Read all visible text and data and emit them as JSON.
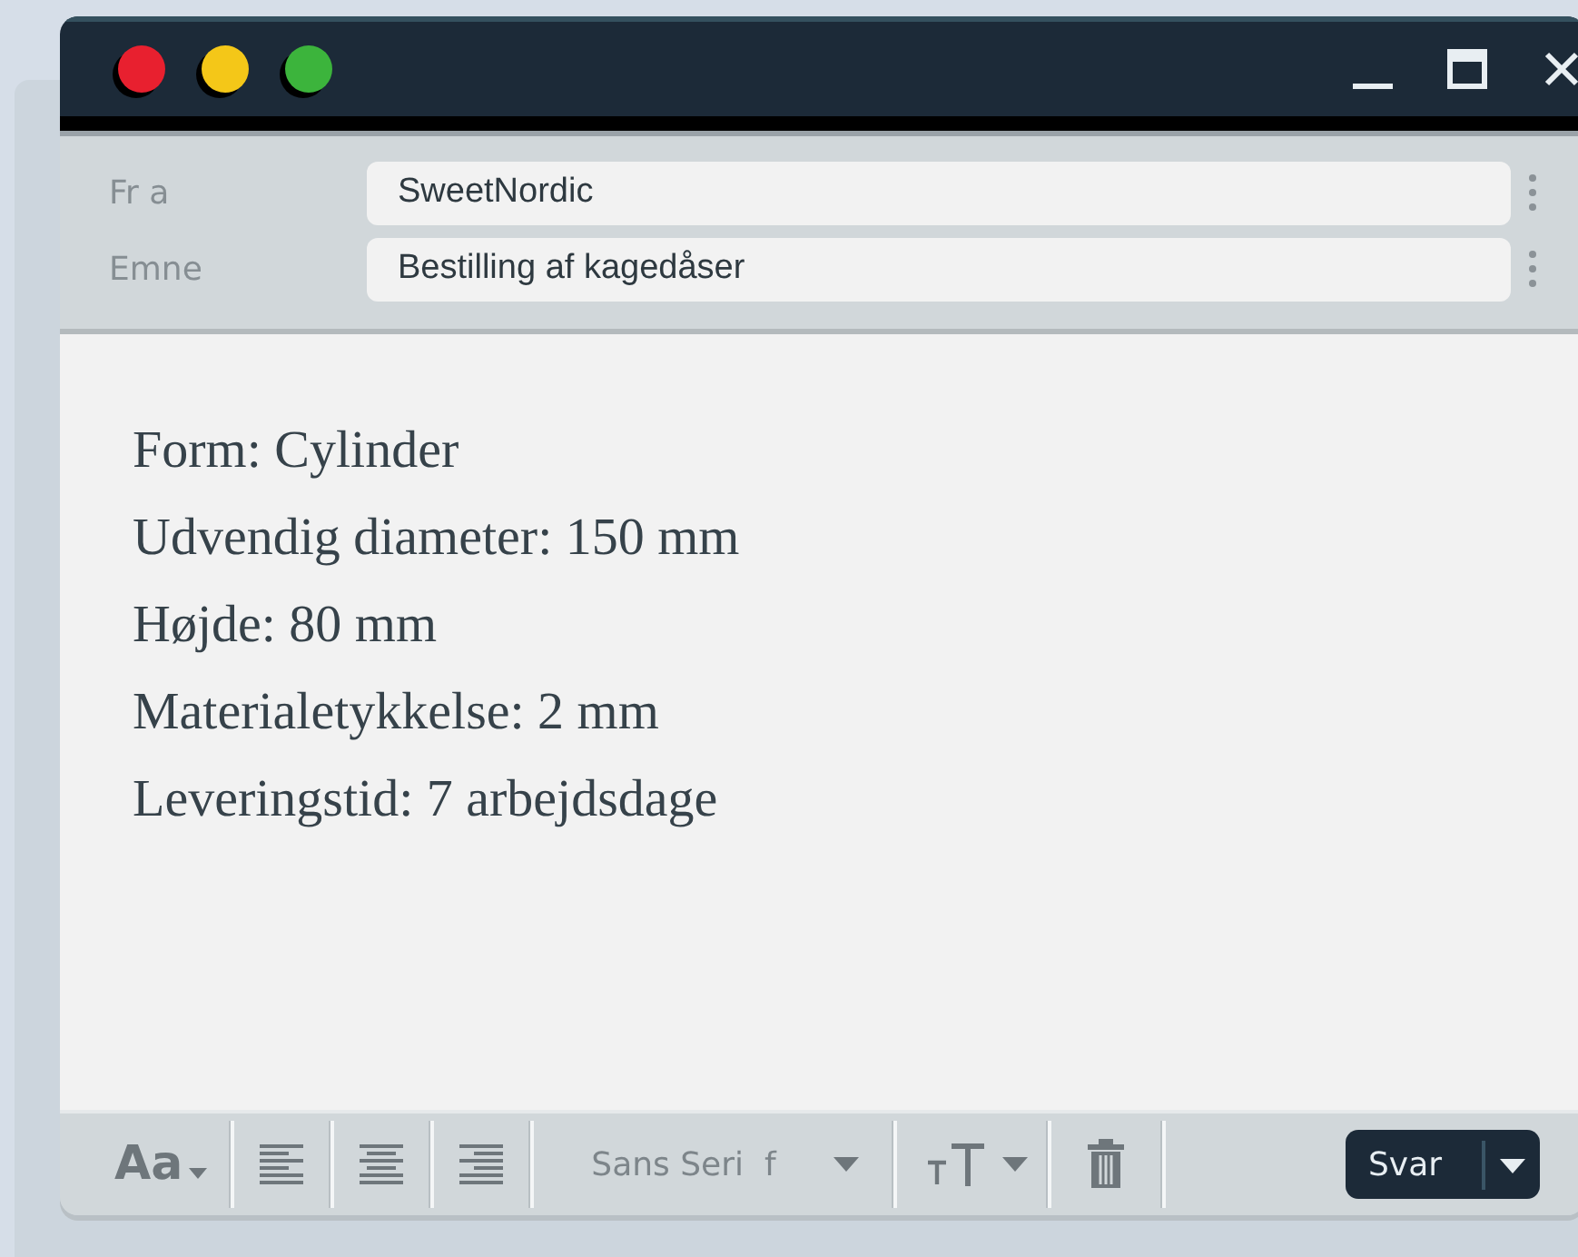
{
  "window": {
    "controls": [
      {
        "kind": "minimize"
      },
      {
        "kind": "maximize"
      },
      {
        "kind": "close"
      }
    ]
  },
  "header": {
    "fields": [
      {
        "label": "Fr a",
        "value": "SweetNordic"
      },
      {
        "label": "Emne",
        "value": "Bestilling af kagedåser"
      }
    ]
  },
  "body": {
    "lines": [
      "Form: Cylinder",
      "Udvendig diameter: 150 mm",
      "Højde: 80 mm",
      "Materialetykkelse: 2 mm",
      "Leveringstid: 7 arbejdsdage"
    ]
  },
  "toolbar": {
    "format_label": "Aa",
    "font": "Sans Seri  f",
    "send_button": "Svar"
  }
}
